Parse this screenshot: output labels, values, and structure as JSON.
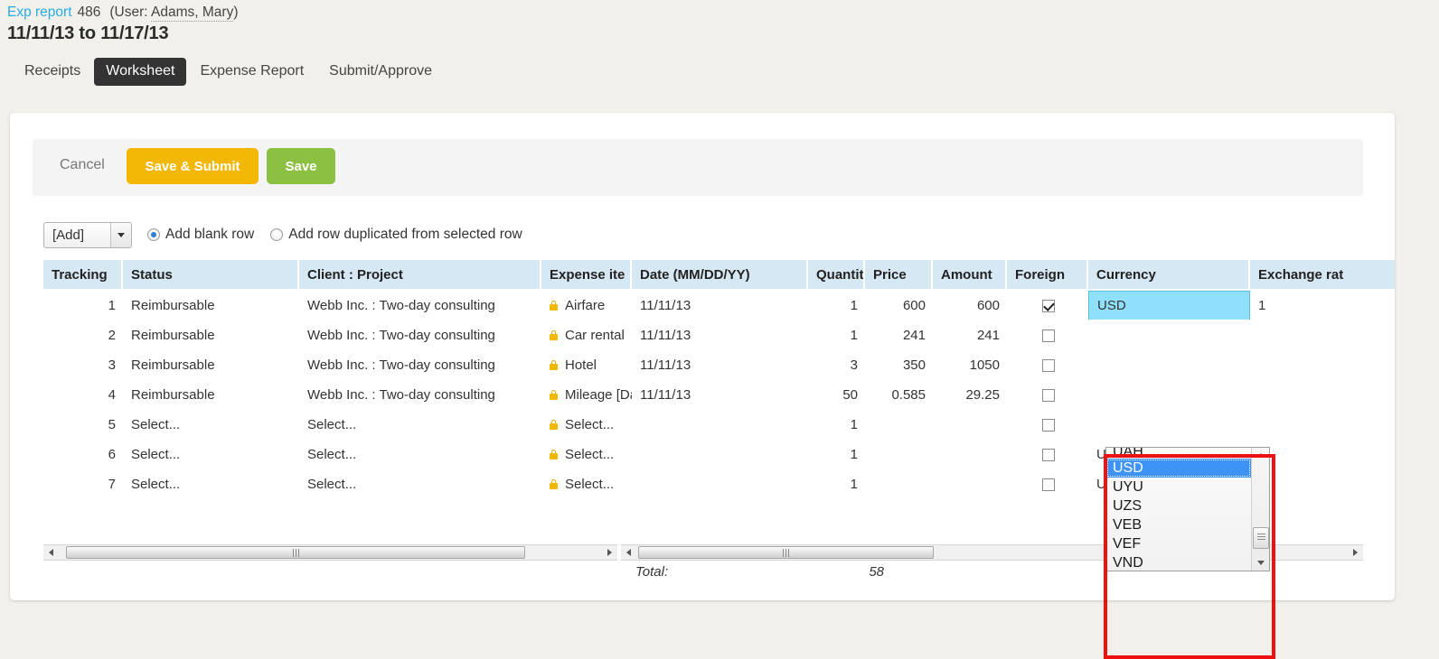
{
  "header": {
    "breadcrumb_link": "Exp report",
    "report_number": "486",
    "user_prefix": "(User:",
    "user_name": "Adams, Mary",
    "user_suffix": ")",
    "date_range": "11/11/13 to 11/17/13"
  },
  "tabs": [
    {
      "label": "Receipts",
      "active": false
    },
    {
      "label": "Worksheet",
      "active": true
    },
    {
      "label": "Expense Report",
      "active": false
    },
    {
      "label": "Submit/Approve",
      "active": false
    }
  ],
  "actions": {
    "cancel_label": "Cancel",
    "save_submit_label": "Save & Submit",
    "save_label": "Save",
    "save_submit_color": "#f3b806",
    "save_color": "#8cc043"
  },
  "add_controls": {
    "select_value": "[Add]",
    "radio_blank_label": "Add blank row",
    "radio_dup_label": "Add row duplicated from selected row",
    "radio_blank_checked": true,
    "radio_dup_checked": false
  },
  "grid": {
    "columns": [
      "Tracking",
      "Status",
      "Client : Project",
      "Expense ite",
      "Date (MM/DD/YY)",
      "Quantit",
      "Price",
      "Amount",
      "Foreign",
      "Currency",
      "Exchange rat"
    ],
    "rows": [
      {
        "tracking": "1",
        "status": "Reimbursable",
        "client": "Webb Inc. : Two-day consulting",
        "expense": "Airfare",
        "date": "11/11/13",
        "qty": "1",
        "price": "600",
        "amount": "600",
        "foreign": true,
        "currency": "USD",
        "exrate": "1"
      },
      {
        "tracking": "2",
        "status": "Reimbursable",
        "client": "Webb Inc. : Two-day consulting",
        "expense": "Car rental",
        "date": "11/11/13",
        "qty": "1",
        "price": "241",
        "amount": "241",
        "foreign": false,
        "currency": "",
        "exrate": ""
      },
      {
        "tracking": "3",
        "status": "Reimbursable",
        "client": "Webb Inc. : Two-day consulting",
        "expense": "Hotel",
        "date": "11/11/13",
        "qty": "3",
        "price": "350",
        "amount": "1050",
        "foreign": false,
        "currency": "",
        "exrate": ""
      },
      {
        "tracking": "4",
        "status": "Reimbursable",
        "client": "Webb Inc. : Two-day consulting",
        "expense": "Mileage [Dat",
        "date": "11/11/13",
        "qty": "50",
        "price": "0.585",
        "amount": "29.25",
        "foreign": false,
        "currency": "",
        "exrate": ""
      },
      {
        "tracking": "5",
        "status": "Select...",
        "client": "Select...",
        "expense": "Select...",
        "date": "",
        "qty": "1",
        "price": "",
        "amount": "",
        "foreign": false,
        "currency": "",
        "exrate": ""
      },
      {
        "tracking": "6",
        "status": "Select...",
        "client": "Select...",
        "expense": "Select...",
        "date": "",
        "qty": "1",
        "price": "",
        "amount": "",
        "foreign": false,
        "currency": "USD",
        "exrate": ""
      },
      {
        "tracking": "7",
        "status": "Select...",
        "client": "Select...",
        "expense": "Select...",
        "date": "",
        "qty": "1",
        "price": "",
        "amount": "",
        "foreign": false,
        "currency": "USD",
        "exrate": ""
      }
    ],
    "selected_cell": {
      "row": 1,
      "column": "Currency",
      "value": "USD",
      "color": "#8ee0fb"
    },
    "header_color": "#d6e8f3"
  },
  "currency_dropdown": {
    "open": true,
    "partial_top_item": "UAH",
    "items": [
      "USD",
      "UYU",
      "UZS",
      "VEB",
      "VEF",
      "VND"
    ],
    "selected": "USD",
    "selected_color": "#3d94f6"
  },
  "annotation": {
    "highlight_color": "#ee1111"
  },
  "total": {
    "label": "Total:",
    "value": "58"
  }
}
